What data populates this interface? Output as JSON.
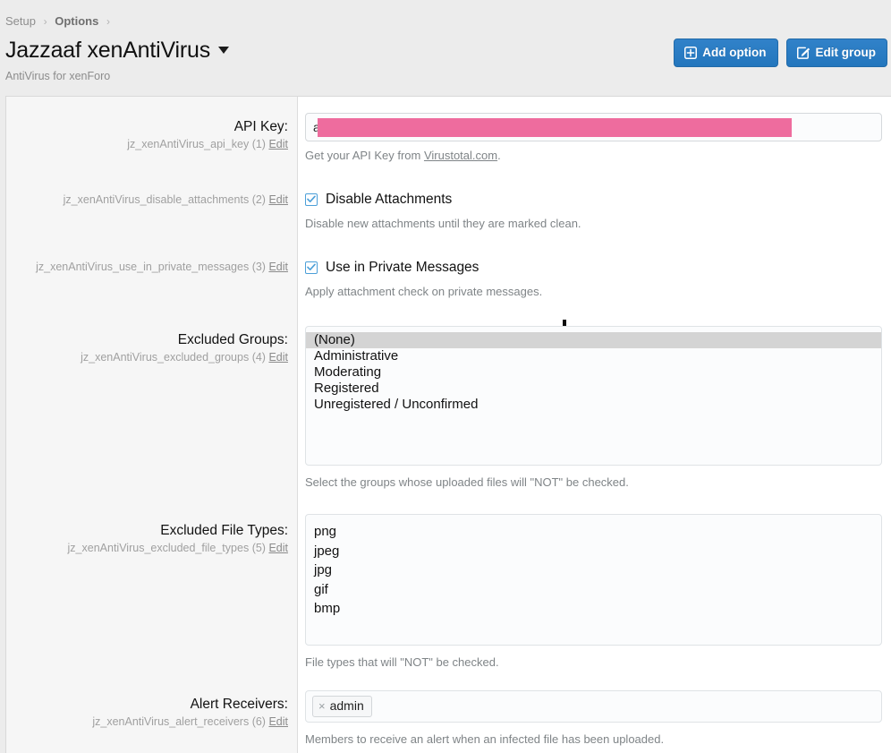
{
  "breadcrumb": {
    "items": [
      {
        "label": "Setup",
        "strong": false
      },
      {
        "label": "Options",
        "strong": true
      }
    ],
    "separator": "›"
  },
  "header": {
    "title": "Jazzaaf xenAntiVirus",
    "subtitle": "AntiVirus for xenForo",
    "caret_icon": "chevron-down-icon",
    "buttons": [
      {
        "label": "Add option",
        "icon": "plus-square-icon"
      },
      {
        "label": "Edit group",
        "icon": "pencil-square-icon"
      }
    ]
  },
  "accent_color": "#2b7cc4",
  "redaction_color": "#ee6c9e",
  "options": [
    {
      "title": "API Key:",
      "option_id": "jz_xenAntiVirus_api_key",
      "number": "(1)",
      "edit_label": "Edit",
      "type": "text",
      "value": "a",
      "redacted": true,
      "hint_prefix": "Get your API Key from ",
      "hint_link": "Virustotal.com",
      "hint_suffix": "."
    },
    {
      "title": "",
      "option_id": "jz_xenAntiVirus_disable_attachments",
      "number": "(2)",
      "edit_label": "Edit",
      "type": "checkbox",
      "checked": true,
      "checkbox_label": "Disable Attachments",
      "hint": "Disable new attachments until they are marked clean."
    },
    {
      "title": "",
      "option_id": "jz_xenAntiVirus_use_in_private_messages",
      "number": "(3)",
      "edit_label": "Edit",
      "type": "checkbox",
      "checked": true,
      "checkbox_label": "Use in Private Messages",
      "hint": "Apply attachment check on private messages."
    },
    {
      "title": "Excluded Groups:",
      "option_id": "jz_xenAntiVirus_excluded_groups",
      "number": "(4)",
      "edit_label": "Edit",
      "type": "multiselect",
      "selected": "(None)",
      "items": [
        "(None)",
        "Administrative",
        "Moderating",
        "Registered",
        "Unregistered / Unconfirmed"
      ],
      "hint": "Select the groups whose uploaded files will \"NOT\" be checked."
    },
    {
      "title": "Excluded File Types:",
      "option_id": "jz_xenAntiVirus_excluded_file_types",
      "number": "(5)",
      "edit_label": "Edit",
      "type": "textarea",
      "value": "png\njpeg\njpg\ngif\nbmp",
      "hint": "File types that will \"NOT\" be checked."
    },
    {
      "title": "Alert Receivers:",
      "option_id": "jz_xenAntiVirus_alert_receivers",
      "number": "(6)",
      "edit_label": "Edit",
      "type": "tokens",
      "tokens": [
        {
          "label": "admin",
          "remove_icon": "×"
        }
      ],
      "hint": "Members to receive an alert when an infected file has been uploaded."
    }
  ]
}
